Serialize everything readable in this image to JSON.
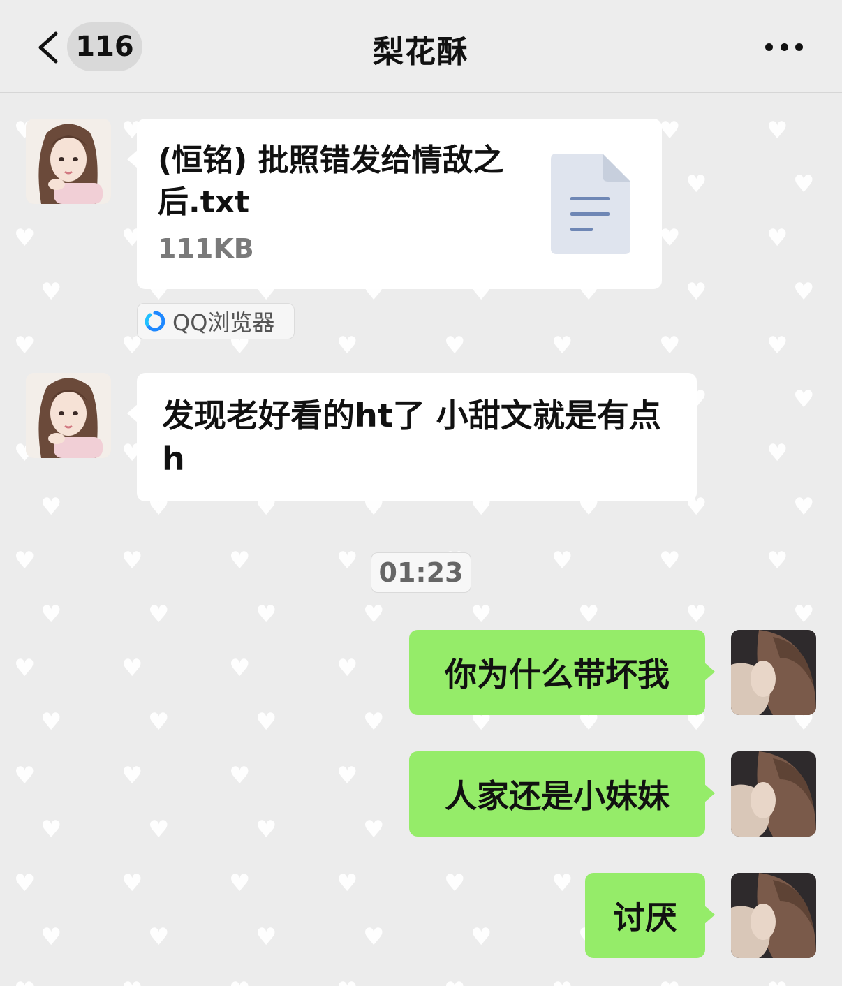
{
  "header": {
    "unread_count": "116",
    "title": "梨花酥"
  },
  "messages": [
    {
      "type": "file",
      "direction": "incoming",
      "file_name": "(恒铭) 批照错发给情敌之后.txt",
      "file_size": "111KB",
      "source_app": "QQ浏览器"
    },
    {
      "type": "text",
      "direction": "incoming",
      "text": "发现老好看的ht了 小甜文就是有点h"
    },
    {
      "type": "timestamp",
      "text": "01:23"
    },
    {
      "type": "text",
      "direction": "outgoing",
      "text": "你为什么带坏我"
    },
    {
      "type": "text",
      "direction": "outgoing",
      "text": "人家还是小妹妹"
    },
    {
      "type": "text",
      "direction": "outgoing",
      "text": "讨厌"
    }
  ],
  "colors": {
    "outgoing_bubble": "#95ec69",
    "incoming_bubble": "#ffffff",
    "background": "#ececec",
    "file_icon": "#dfe4ee",
    "file_icon_lines": "#6f87b5"
  },
  "icons": {
    "back": "chevron-left-icon",
    "more": "ellipsis-icon",
    "file": "document-icon",
    "source_app": "qq-browser-icon"
  }
}
